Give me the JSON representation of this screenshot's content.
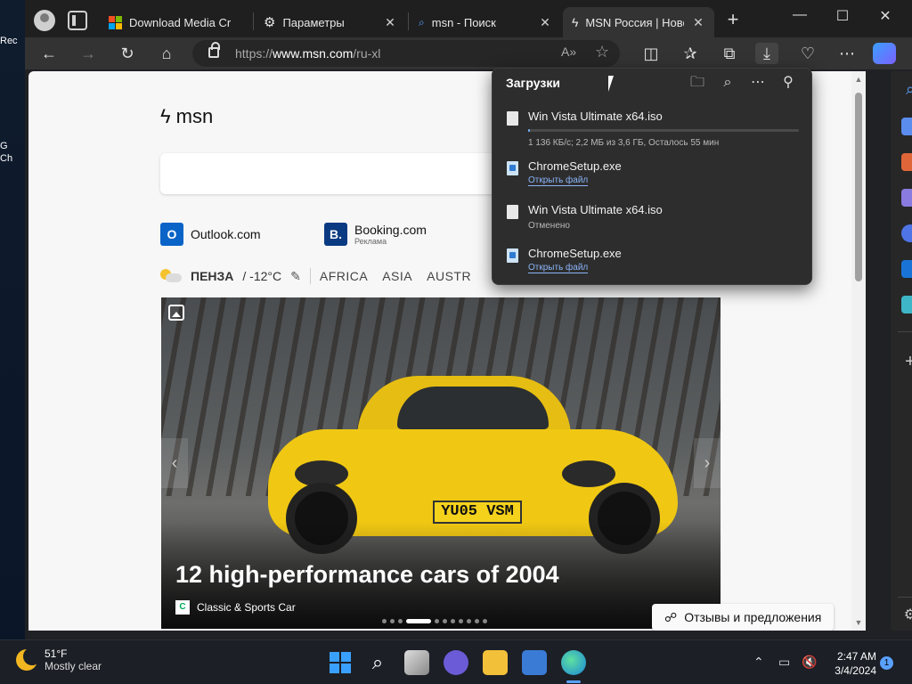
{
  "desktop": {
    "icon_labels": [
      "Rec",
      "G",
      "Ch"
    ]
  },
  "tabs": [
    {
      "title": "Download Media Cr",
      "icon": "microsoft-logo-icon"
    },
    {
      "title": "Параметры",
      "icon": "gear-icon"
    },
    {
      "title": "msn - Поиск",
      "icon": "search-icon"
    },
    {
      "title": "MSN Россия | Ново",
      "icon": "msn-butterfly-icon"
    }
  ],
  "address": {
    "url_prefix": "https://",
    "url_host": "www.msn.com",
    "url_path": "/ru-xl"
  },
  "page": {
    "logo": "msn",
    "quick_links": [
      {
        "label": "Outlook.com",
        "sub": ""
      },
      {
        "label": "Booking.com",
        "sub": "Реклама"
      }
    ],
    "weather_city": "ПЕНЗА",
    "weather_temp": "/ -12°C",
    "nav": [
      "AFRICA",
      "ASIA",
      "AUSTR"
    ],
    "hero": {
      "headline": "12 high-performance cars of 2004",
      "source": "Classic & Sports Car",
      "plate": "YU05 VSM"
    },
    "feedback": "Отзывы и предложения"
  },
  "downloads": {
    "title": "Загрузки",
    "items": [
      {
        "name": "Win Vista Ultimate x64.iso",
        "status": "1 136 КБ/с; 2,2 МБ из 3,6 ГБ, Осталось 55 мин",
        "progress": 0.001,
        "type": "iso"
      },
      {
        "name": "ChromeSetup.exe",
        "link": "Открыть файл",
        "type": "exe"
      },
      {
        "name": "Win Vista Ultimate x64.iso",
        "status": "Отменено",
        "type": "iso"
      },
      {
        "name": "ChromeSetup.exe",
        "link": "Открыть файл",
        "type": "exe"
      }
    ]
  },
  "taskbar": {
    "weather_temp": "51°F",
    "weather_cond": "Mostly clear",
    "time": "2:47 AM",
    "date": "3/4/2024",
    "notifications": "1"
  },
  "colors": {
    "accent": "#6fb4ff",
    "link": "#8ab4f8",
    "car_yellow": "#f0c814"
  }
}
